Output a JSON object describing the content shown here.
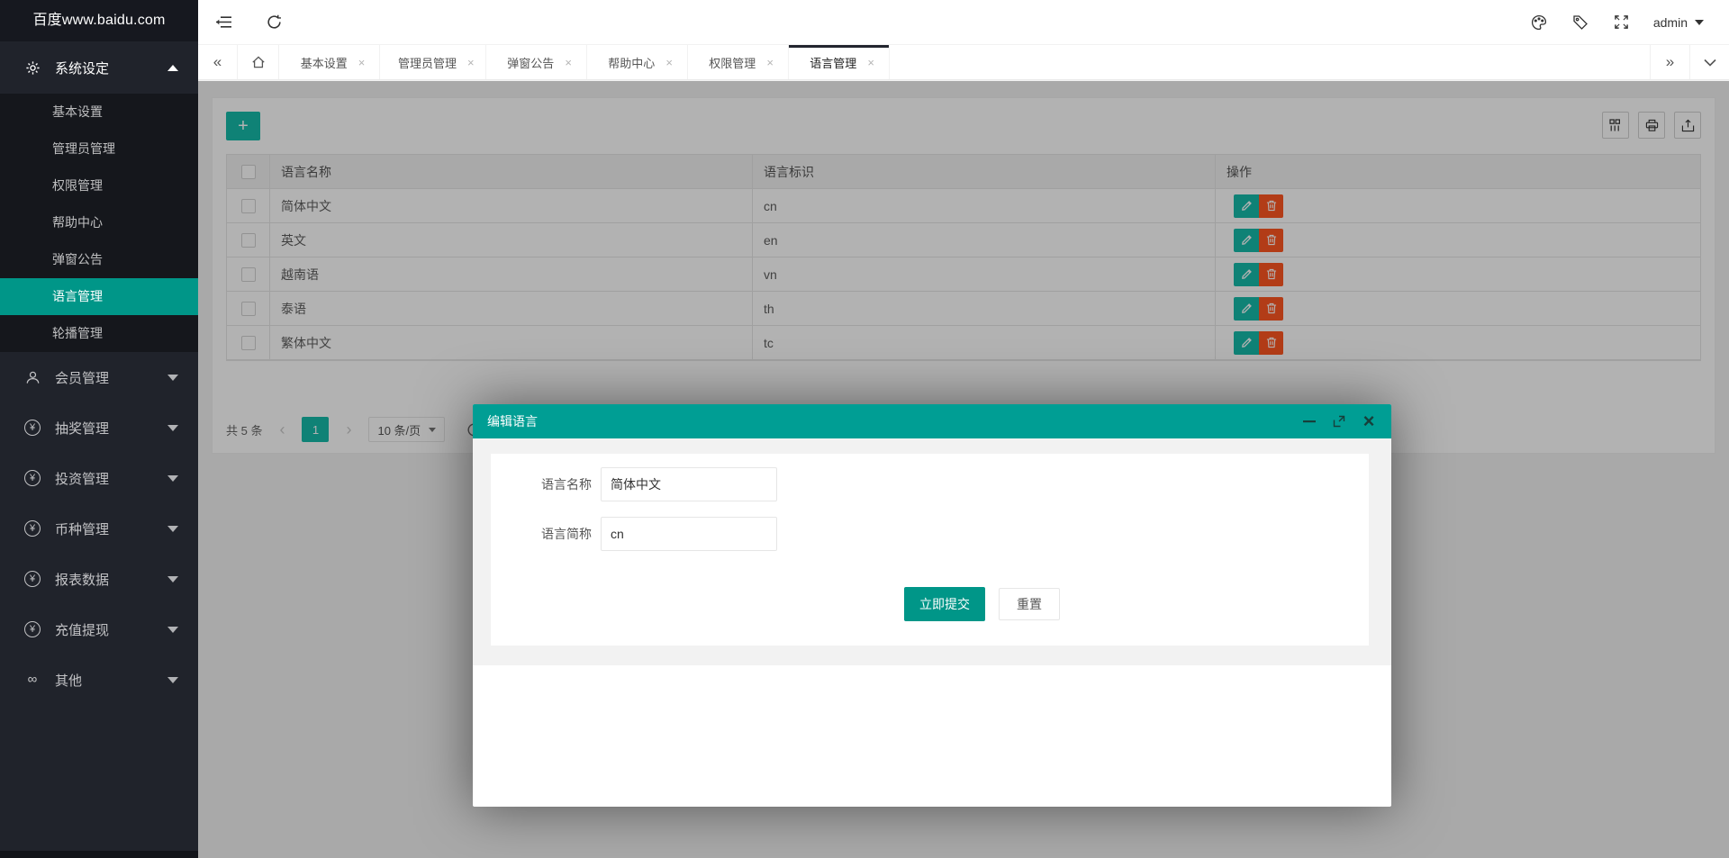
{
  "app": {
    "logo": "百度www.baidu.com"
  },
  "topbar": {
    "user": "admin"
  },
  "tabbar": {
    "tabs": [
      {
        "label": "基本设置"
      },
      {
        "label": "管理员管理"
      },
      {
        "label": "弹窗公告"
      },
      {
        "label": "帮助中心"
      },
      {
        "label": "权限管理"
      },
      {
        "label": "语言管理"
      }
    ]
  },
  "sidebar": {
    "system_group": "系统设定",
    "submenu": [
      {
        "label": "基本设置"
      },
      {
        "label": "管理员管理"
      },
      {
        "label": "权限管理"
      },
      {
        "label": "帮助中心"
      },
      {
        "label": "弹窗公告"
      },
      {
        "label": "语言管理"
      },
      {
        "label": "轮播管理"
      }
    ],
    "groups": [
      {
        "label": "会员管理",
        "icon": "user-icon"
      },
      {
        "label": "抽奖管理",
        "icon": "yen-icon"
      },
      {
        "label": "投资管理",
        "icon": "yen-icon"
      },
      {
        "label": "币种管理",
        "icon": "yen-icon"
      },
      {
        "label": "报表数据",
        "icon": "yen-icon"
      },
      {
        "label": "充值提现",
        "icon": "yen-icon"
      },
      {
        "label": "其他",
        "icon": "infinity-icon"
      }
    ]
  },
  "table": {
    "headers": {
      "name": "语言名称",
      "code": "语言标识",
      "ops": "操作"
    },
    "rows": [
      {
        "name": "简体中文",
        "code": "cn"
      },
      {
        "name": "英文",
        "code": "en"
      },
      {
        "name": "越南语",
        "code": "vn"
      },
      {
        "name": "泰语",
        "code": "th"
      },
      {
        "name": "繁体中文",
        "code": "tc"
      }
    ]
  },
  "pagination": {
    "total": "共 5 条",
    "page": "1",
    "page_size": "10 条/页"
  },
  "modal": {
    "title": "编辑语言",
    "fields": [
      {
        "label": "语言名称",
        "value": "简体中文"
      },
      {
        "label": "语言简称",
        "value": "cn"
      }
    ],
    "submit_label": "立即提交",
    "reset_label": "重置"
  },
  "colors": {
    "accent": "#009688",
    "accent_light": "#16baaa",
    "danger": "#ff5722",
    "sidebar": "#20232B"
  }
}
